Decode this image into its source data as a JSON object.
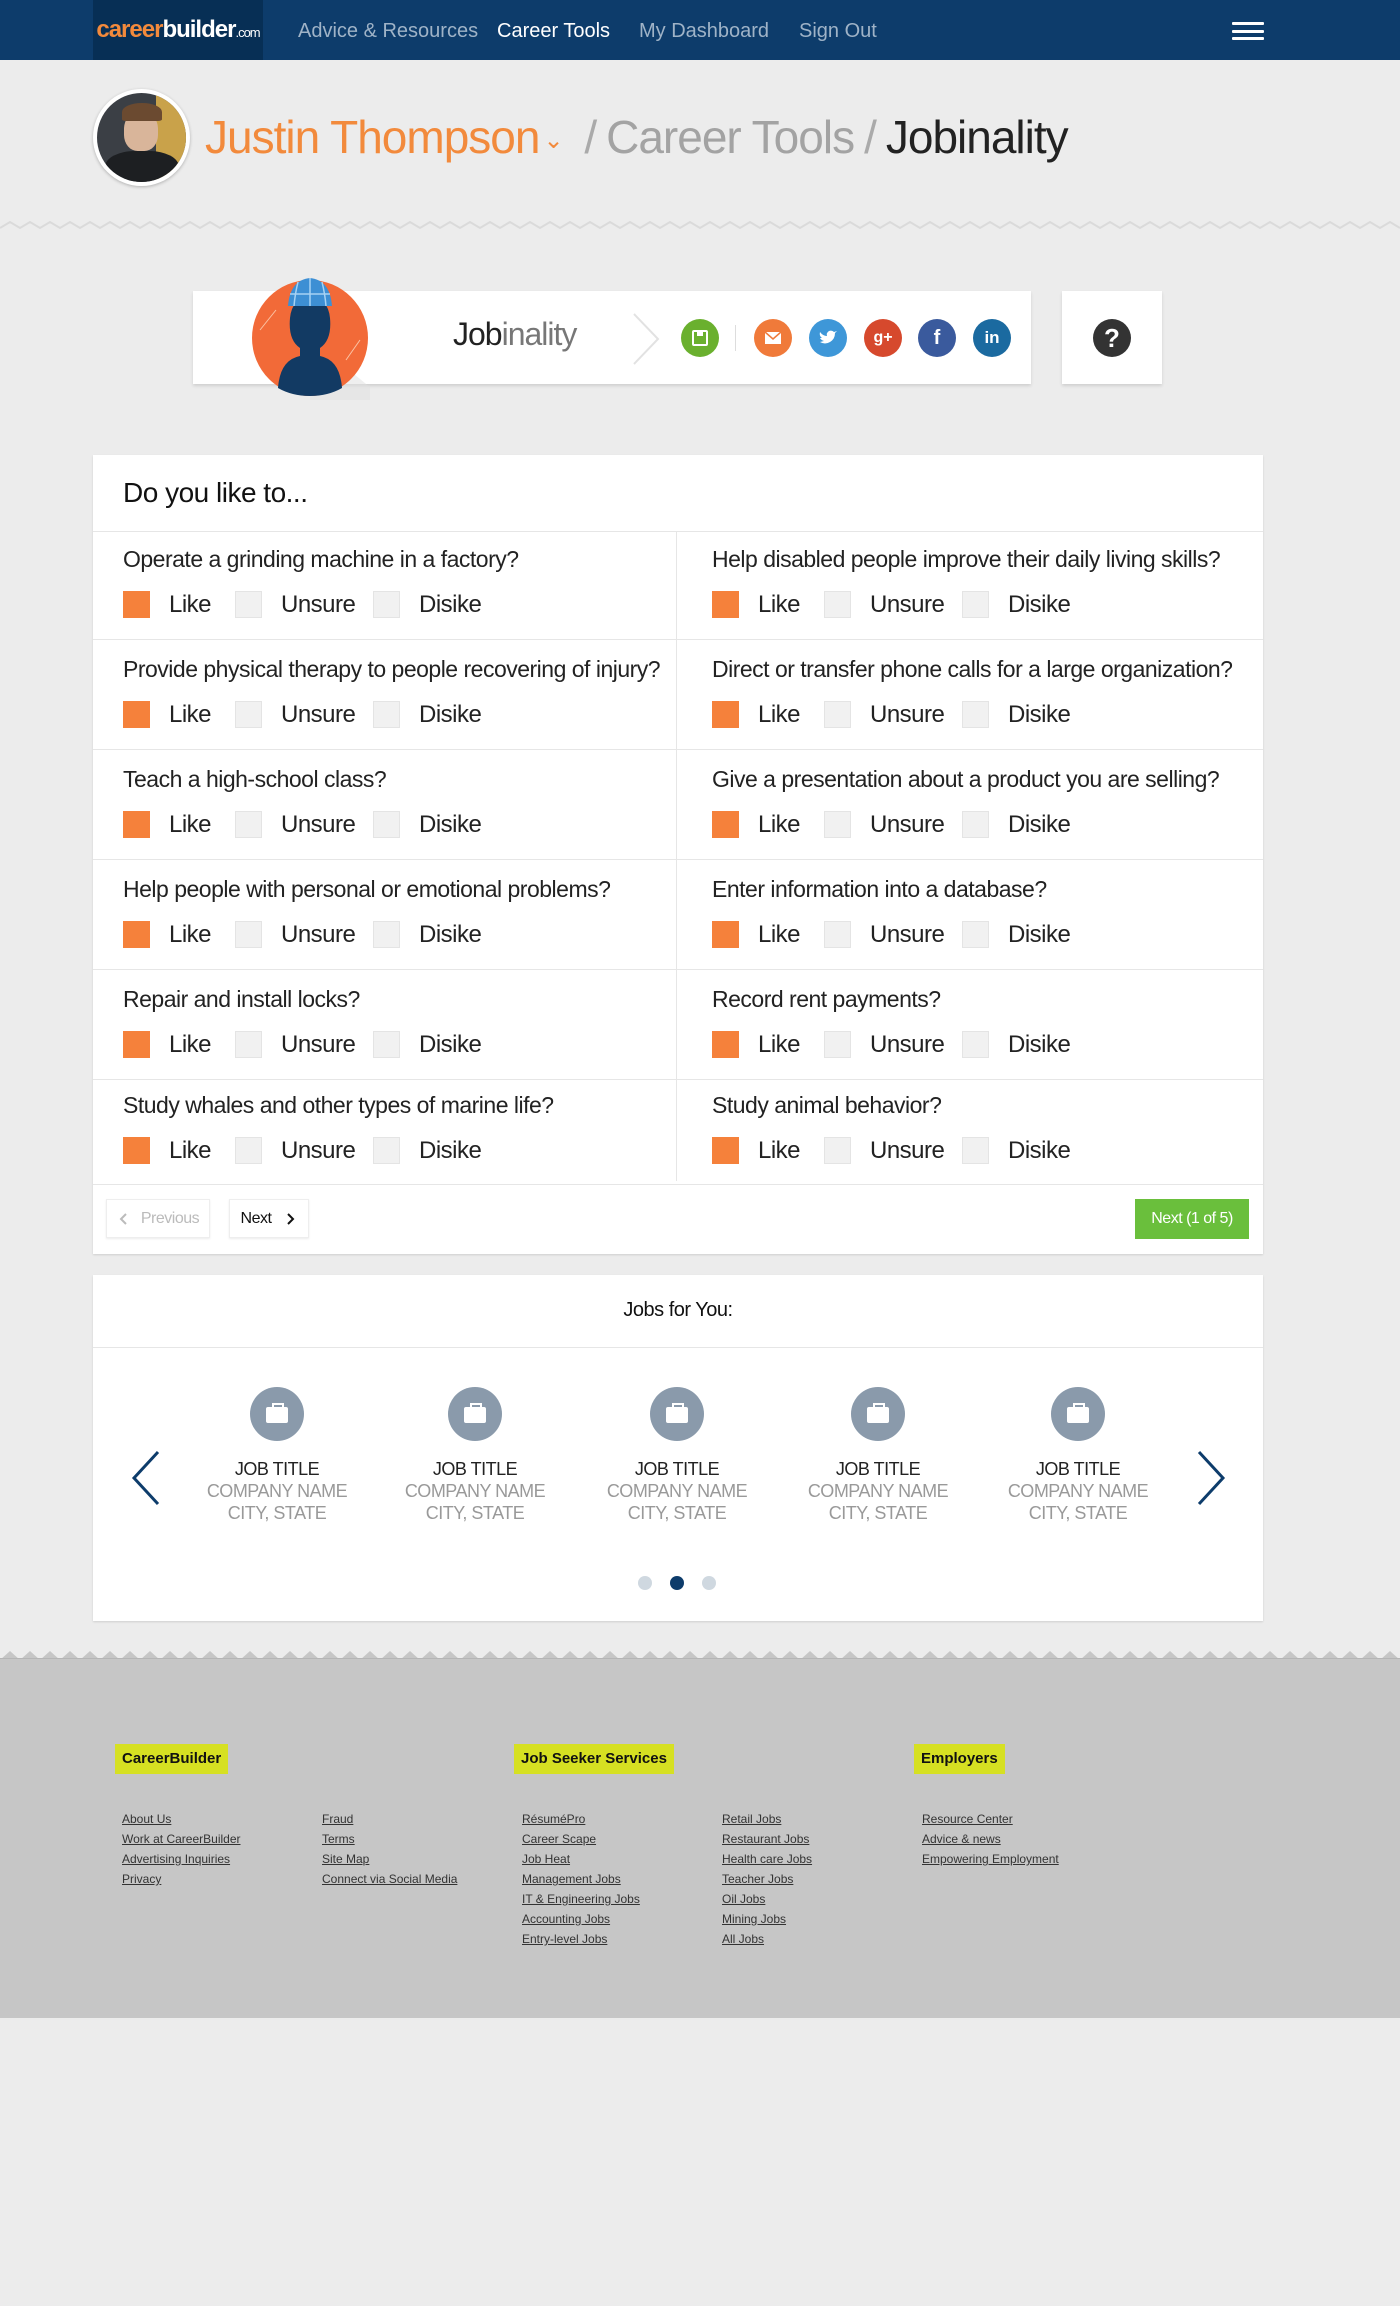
{
  "nav": {
    "logo_main": "career",
    "logo_brand": "builder",
    "logo_suffix": ".com",
    "links": [
      "Advice & Resources",
      "Career Tools",
      "My Dashboard",
      "Sign Out"
    ]
  },
  "header": {
    "user_name": "Justin Thompson",
    "chevron": "⌄",
    "sep": "/",
    "crumb_mid": "Career Tools",
    "crumb_last": "Jobinality"
  },
  "tool": {
    "title_bold": "Job",
    "title_thin": "inality",
    "social_icons": [
      "save-icon",
      "email-icon",
      "twitter-icon",
      "google-plus-icon",
      "facebook-icon",
      "linkedin-icon"
    ],
    "help": "?"
  },
  "quiz": {
    "heading": "Do you like to...",
    "option_labels": [
      "Like",
      "Unsure",
      "Disike"
    ],
    "questions": [
      "Operate a grinding machine in a factory?",
      "Help disabled people improve their daily living skills?",
      "Provide physical therapy to people recovering of injury?",
      "Direct or transfer phone calls for a large organization?",
      "Teach a high-school class?",
      "Give a presentation about a product you are selling?",
      "Help people with personal or emotional problems?",
      "Enter information into a database?",
      "Repair and install locks?",
      "Record rent payments?",
      "Study whales and other types of marine life?",
      "Study animal behavior?"
    ],
    "selected": "Like",
    "prev_label": "Previous",
    "next_label": "Next",
    "next_progress_label": "Next (1 of 5)"
  },
  "jobs": {
    "heading": "Jobs for You:",
    "items": [
      {
        "title": "JOB TITLE",
        "company": "COMPANY NAME",
        "location": "CITY, STATE"
      },
      {
        "title": "JOB TITLE",
        "company": "COMPANY NAME",
        "location": "CITY, STATE"
      },
      {
        "title": "JOB TITLE",
        "company": "COMPANY NAME",
        "location": "CITY, STATE"
      },
      {
        "title": "JOB TITLE",
        "company": "COMPANY NAME",
        "location": "CITY, STATE"
      },
      {
        "title": "JOB TITLE",
        "company": "COMPANY NAME",
        "location": "CITY, STATE"
      }
    ],
    "active_page": 2,
    "page_count": 3
  },
  "footer": {
    "col1_heading": "CareerBuilder",
    "col1_links_a": [
      "About Us",
      "Work at CareerBuilder",
      "Advertising Inquiries",
      "Privacy"
    ],
    "col1_links_b": [
      "Fraud",
      "Terms",
      "Site Map",
      "Connect via Social Media"
    ],
    "col2_heading": "Job Seeker Services",
    "col2_links_a": [
      "RésuméPro",
      "Career Scape",
      "Job Heat",
      "Management Jobs",
      "IT & Engineering Jobs",
      "Accounting Jobs",
      "Entry-level Jobs"
    ],
    "col2_links_b": [
      "Retail Jobs",
      "Restaurant Jobs",
      "Health care Jobs ",
      "Teacher Jobs",
      "Oil Jobs",
      "Mining Jobs",
      "All Jobs"
    ],
    "col3_heading": "Employers",
    "col3_links": [
      "Resource Center",
      "Advice & news",
      "Empowering Employment"
    ]
  },
  "colors": {
    "nav": "#0d3c6b",
    "accent_orange": "#f5813b",
    "green": "#6abf3c",
    "footer_tag": "#d6e022"
  }
}
